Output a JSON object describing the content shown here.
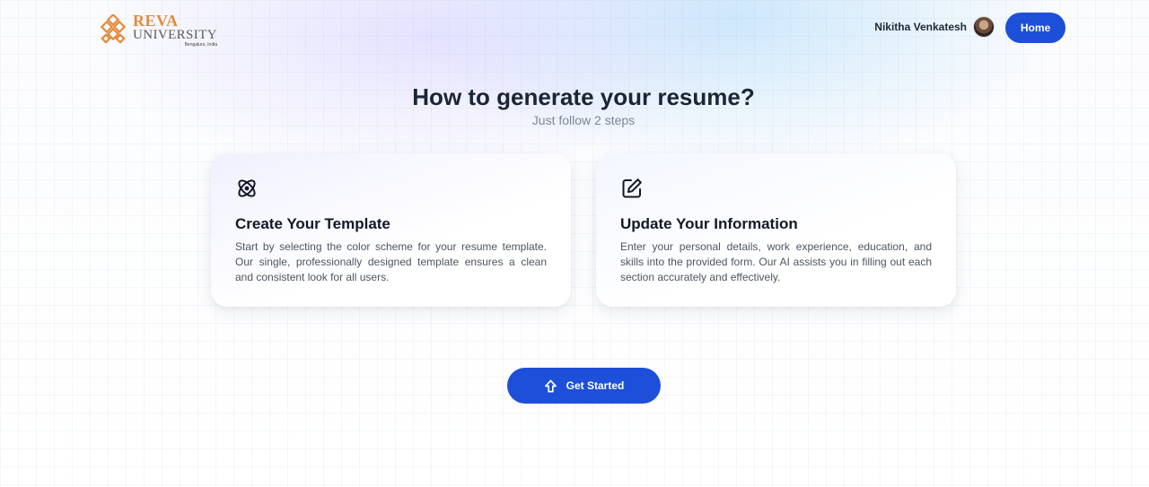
{
  "header": {
    "logo": {
      "name": "REVA",
      "subname": "UNIVERSITY",
      "location": "Bengaluru, India"
    },
    "user": {
      "name": "Nikitha Venkatesh"
    },
    "home_button": "Home"
  },
  "main": {
    "title": "How to generate your resume?",
    "subtitle": "Just follow 2 steps",
    "cards": [
      {
        "icon": "atom-icon",
        "title": "Create Your Template",
        "text": "Start by selecting the color scheme for your resume template. Our single, professionally designed template ensures a clean and consistent look for all users."
      },
      {
        "icon": "edit-icon",
        "title": "Update Your Information",
        "text": "Enter your personal details, work experience, education, and skills into the provided form. Our AI assists you in filling out each section accurately and effectively."
      }
    ],
    "cta": {
      "icon": "upload-arrow-icon",
      "label": "Get Started"
    }
  },
  "colors": {
    "primary": "#1d4fd8",
    "logo_orange": "#e38b3b",
    "title": "#1b2537",
    "subtitle": "#7a8596"
  }
}
